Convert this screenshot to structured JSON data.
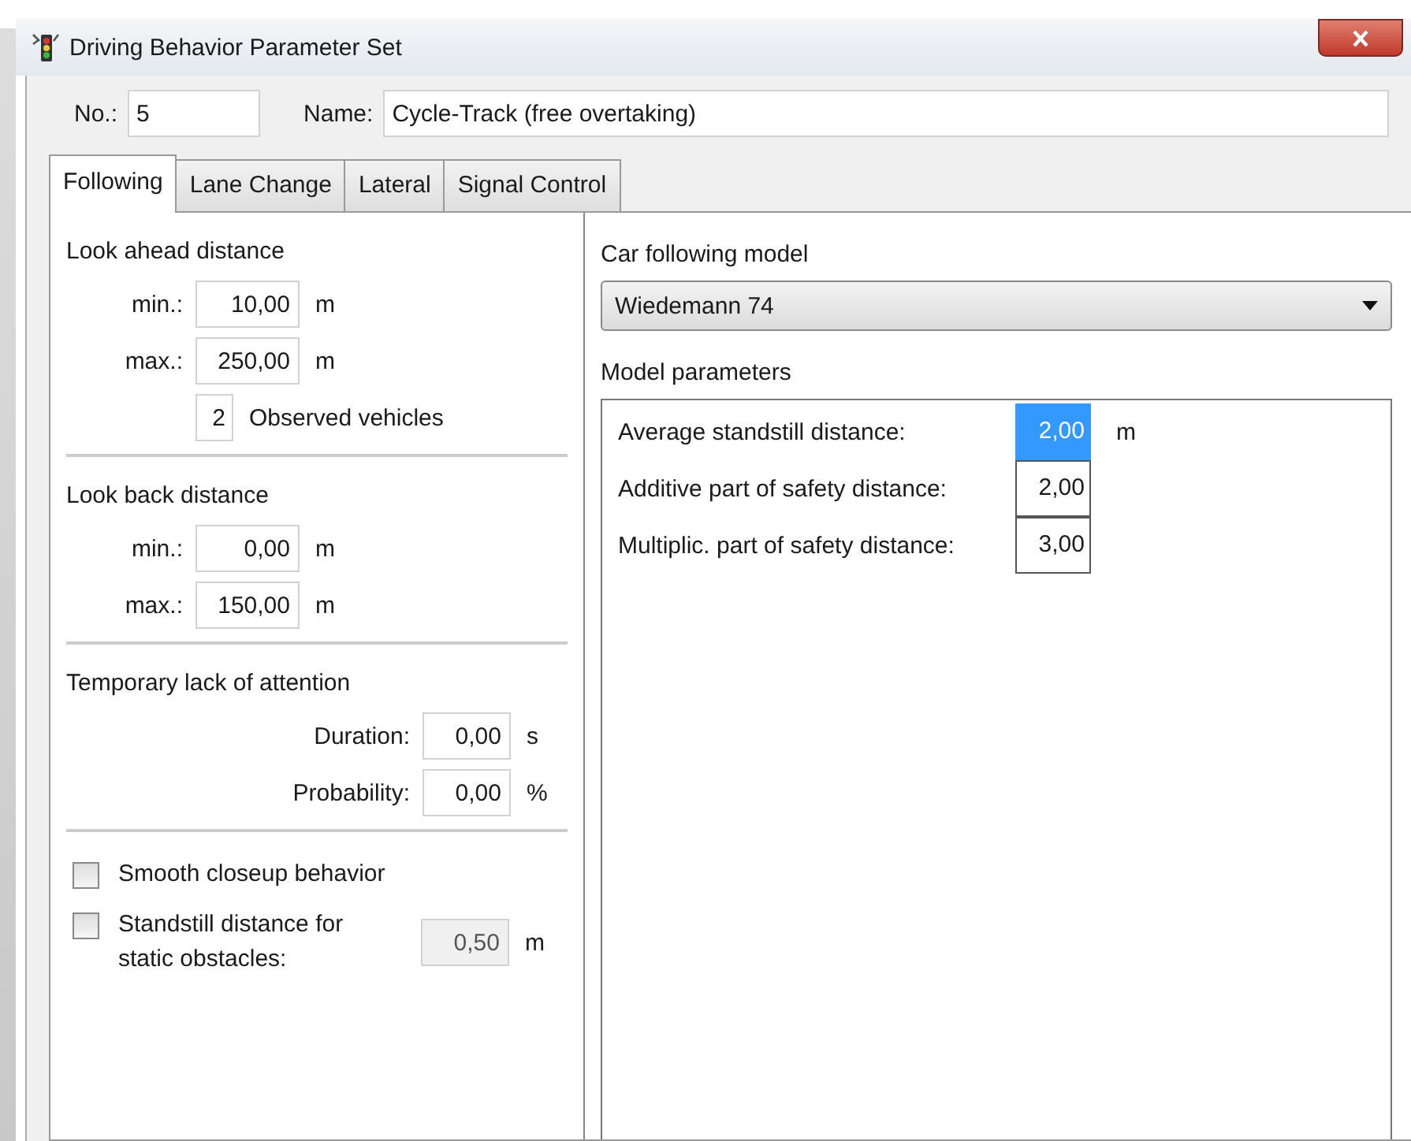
{
  "window": {
    "title": "Driving Behavior Parameter Set"
  },
  "number": {
    "label": "No.:",
    "value": "5"
  },
  "name": {
    "label": "Name:",
    "value": "Cycle-Track (free overtaking)"
  },
  "tabs": [
    {
      "label": "Following",
      "selected": true
    },
    {
      "label": "Lane Change",
      "selected": false
    },
    {
      "label": "Lateral",
      "selected": false
    },
    {
      "label": "Signal Control",
      "selected": false
    }
  ],
  "look_ahead": {
    "title": "Look ahead distance",
    "fields": [
      {
        "label": "min.:",
        "value": "10,00",
        "unit": "m"
      },
      {
        "label": "max.:",
        "value": "250,00",
        "unit": "m"
      }
    ],
    "observed": {
      "value": "2",
      "label": "Observed vehicles"
    }
  },
  "look_back": {
    "title": "Look back distance",
    "fields": [
      {
        "label": "min.:",
        "value": "0,00",
        "unit": "m"
      },
      {
        "label": "max.:",
        "value": "150,00",
        "unit": "m"
      }
    ]
  },
  "attention": {
    "title": "Temporary lack of attention",
    "fields": [
      {
        "label": "Duration:",
        "value": "0,00",
        "unit": "s"
      },
      {
        "label": "Probability:",
        "value": "0,00",
        "unit": "%"
      }
    ]
  },
  "options": [
    {
      "label": "Smooth closeup behavior",
      "checked": false
    },
    {
      "label": "Standstill distance for static obstacles:",
      "checked": false,
      "value": "0,50",
      "unit": "m",
      "disabled": true
    }
  ],
  "car_following": {
    "label": "Car following model",
    "value": "Wiedemann 74"
  },
  "model_parameters": {
    "title": "Model parameters",
    "rows": [
      {
        "label": "Average standstill distance:",
        "value": "2,00",
        "unit": "m",
        "selected": true
      },
      {
        "label": "Additive part of safety distance:",
        "value": "2,00",
        "selected": false
      },
      {
        "label": "Multiplic. part of safety distance:",
        "value": "3,00",
        "selected": false
      }
    ]
  }
}
